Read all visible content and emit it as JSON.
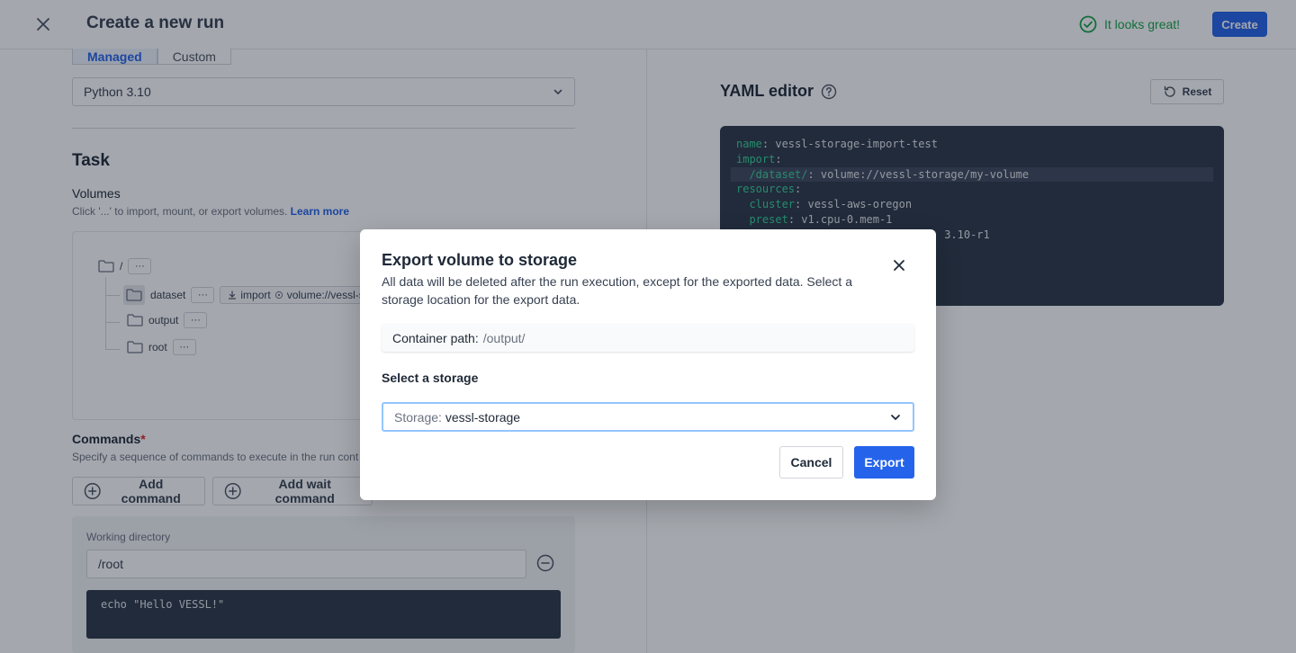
{
  "header": {
    "title": "Create a new run",
    "status_text": "It looks great!",
    "create_label": "Create"
  },
  "runtime": {
    "tabs": [
      "Managed",
      "Custom"
    ],
    "selected_tab": "Managed",
    "python_value": "Python 3.10"
  },
  "task": {
    "title": "Task",
    "volumes_label": "Volumes",
    "volumes_help": "Click '...' to import, mount, or export volumes.",
    "learn_more": "Learn more",
    "tree": {
      "root": "/",
      "dots": "···",
      "items": [
        {
          "name": "dataset",
          "tag_type": "import",
          "tag_value": "volume://vessl-s"
        },
        {
          "name": "output"
        },
        {
          "name": "root"
        }
      ]
    },
    "commands_label": "Commands",
    "commands_required": "*",
    "commands_help": "Specify a sequence of commands to execute in the run cont",
    "add_command": "Add command",
    "add_wait_command": "Add wait command",
    "working_dir_label": "Working directory",
    "working_dir_value": "/root",
    "command_code": "echo \"Hello VESSL!\""
  },
  "yaml": {
    "title": "YAML editor",
    "reset_label": "Reset",
    "lines": [
      {
        "key": "name",
        "value": ": vessl-storage-import-test",
        "indent": ""
      },
      {
        "key": "import",
        "value": ":",
        "indent": ""
      },
      {
        "key": "/dataset/",
        "value": ": volume://vessl-storage/my-volume",
        "indent": "  ",
        "highlight": true
      },
      {
        "key": "resources",
        "value": ":",
        "indent": ""
      },
      {
        "key": "cluster",
        "value": ": vessl-aws-oregon",
        "indent": "  "
      },
      {
        "key": "preset",
        "value": ": v1.cpu-0.mem-1",
        "indent": "  "
      },
      {
        "key": "",
        "value": "3.10-r1",
        "indent": "                                "
      }
    ]
  },
  "modal": {
    "title": "Export volume to storage",
    "description": "All data will be deleted after the run execution, except for the exported data. Select a storage location for the export data.",
    "container_path_label": "Container path:",
    "container_path_value": "/output/",
    "select_label": "Select a storage",
    "storage_label": "Storage:",
    "storage_value": "vessl-storage",
    "cancel_label": "Cancel",
    "export_label": "Export"
  },
  "colors": {
    "accent": "#2563eb",
    "success": "#16a34a",
    "required": "#dc2626",
    "code_bg": "#2d3748",
    "yaml_key": "#34d399"
  }
}
